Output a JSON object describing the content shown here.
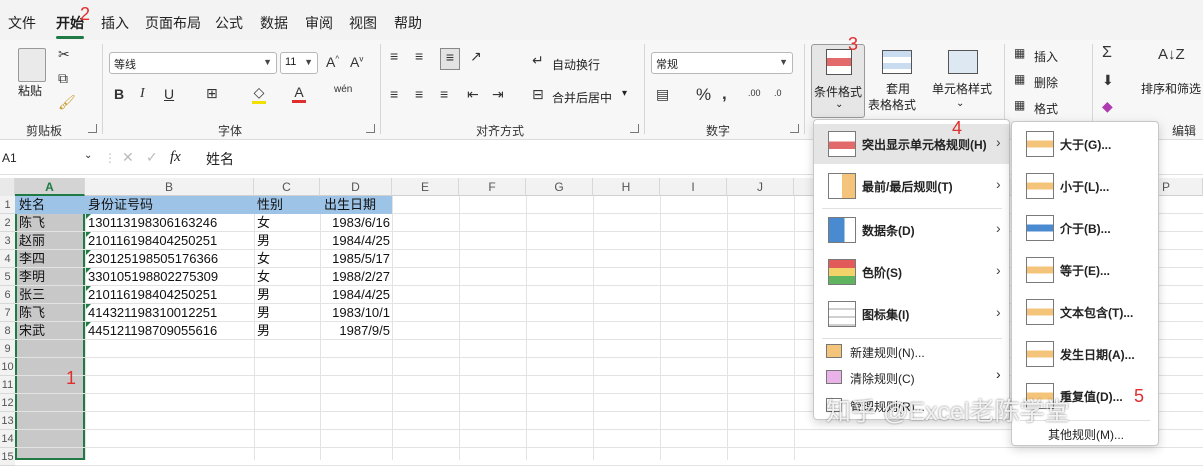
{
  "tabs": [
    "文件",
    "开始",
    "插入",
    "页面布局",
    "公式",
    "数据",
    "审阅",
    "视图",
    "帮助"
  ],
  "annotations": [
    "1",
    "2",
    "3",
    "4",
    "5"
  ],
  "ribbon": {
    "clipboard": {
      "label": "剪贴板",
      "paste": "粘贴"
    },
    "font": {
      "label": "字体",
      "font_name": "等线",
      "font_size": "11"
    },
    "alignment": {
      "label": "对齐方式",
      "wrap": "自动换行",
      "merge": "合并后居中"
    },
    "number": {
      "label": "数字",
      "format": "常规"
    },
    "styles": {
      "cond_format": "条件格式",
      "table_fmt_1": "套用",
      "table_fmt_2": "表格格式",
      "cell_style": "单元格样式"
    },
    "cells": {
      "insert": "插入",
      "delete": "删除",
      "format": "格式"
    },
    "editing": {
      "label": "编辑",
      "sort": "排序和筛选"
    }
  },
  "formula_bar": {
    "name_box": "A1",
    "fx": "fx",
    "content": "姓名"
  },
  "columns": [
    "A",
    "B",
    "C",
    "D",
    "E",
    "F",
    "G",
    "H",
    "I",
    "J",
    "P"
  ],
  "rows": [
    "1",
    "2",
    "3",
    "4",
    "5",
    "6",
    "7",
    "8",
    "9",
    "10",
    "11",
    "12",
    "13",
    "14",
    "15"
  ],
  "table": {
    "headers": [
      "姓名",
      "身份证号码",
      "性别",
      "出生日期"
    ],
    "rows": [
      [
        "陈飞",
        "130113198306163246",
        "女",
        "1983/6/16"
      ],
      [
        "赵丽",
        "210116198404250251",
        "男",
        "1984/4/25"
      ],
      [
        "李四",
        "230125198505176366",
        "女",
        "1985/5/17"
      ],
      [
        "李明",
        "330105198802275309",
        "女",
        "1988/2/27"
      ],
      [
        "张三",
        "210116198404250251",
        "男",
        "1984/4/25"
      ],
      [
        "陈飞",
        "414321198310012251",
        "男",
        "1983/10/1"
      ],
      [
        "宋武",
        "445121198709055616",
        "男",
        "1987/9/5"
      ]
    ]
  },
  "cf_menu": {
    "items": [
      "突出显示单元格规则(H)",
      "最前/最后规则(T)",
      "数据条(D)",
      "色阶(S)",
      "图标集(I)"
    ],
    "small_items": [
      "新建规则(N)...",
      "清除规则(C)",
      "管理规则(R)..."
    ]
  },
  "sub_menu": {
    "items": [
      "大于(G)...",
      "小于(L)...",
      "介于(B)...",
      "等于(E)...",
      "文本包含(T)...",
      "发生日期(A)...",
      "重复值(D)..."
    ],
    "more": "其他规则(M)..."
  },
  "watermark": "知乎 @Excel老陈学堂"
}
